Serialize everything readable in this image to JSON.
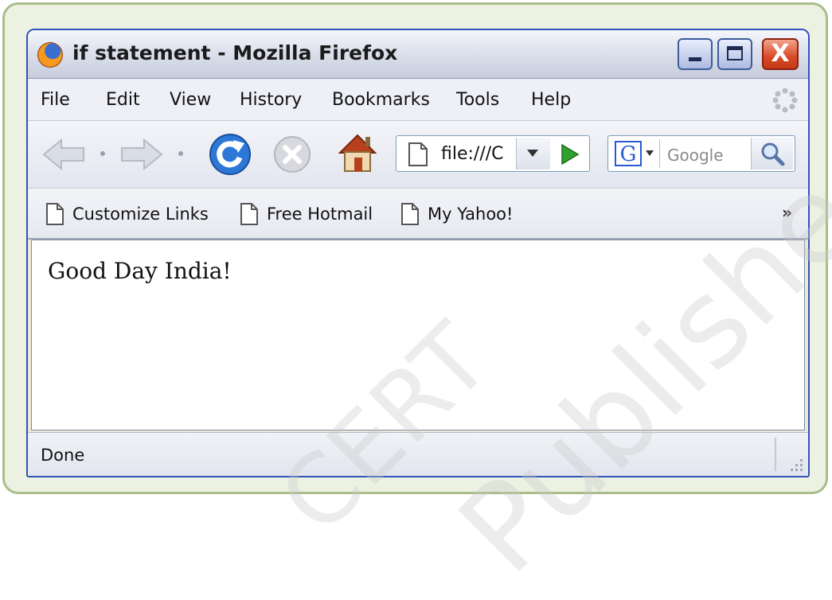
{
  "window": {
    "title": "if statement - Mozilla Firefox",
    "controls": {
      "close_glyph": "X"
    }
  },
  "menubar": {
    "items": [
      {
        "label": "File"
      },
      {
        "label": "Edit"
      },
      {
        "label": "View"
      },
      {
        "label": "History"
      },
      {
        "label": "Bookmarks"
      },
      {
        "label": "Tools"
      },
      {
        "label": "Help"
      }
    ]
  },
  "navbar": {
    "url_value": "file:///C",
    "search_placeholder": "Google",
    "search_engine_letter": "G"
  },
  "bookmarks": {
    "items": [
      {
        "label": "Customize Links"
      },
      {
        "label": "Free Hotmail"
      },
      {
        "label": "My Yahoo!"
      }
    ],
    "overflow": "»"
  },
  "content": {
    "text": "Good Day India!"
  },
  "status": {
    "text": "Done"
  },
  "watermark": {
    "left": "CERT",
    "right": "Published"
  },
  "colors": {
    "frame_border": "#a9bd8a",
    "window_border": "#2f55b8",
    "close_button": "#d84a25",
    "go_arrow": "#2fa12f",
    "reload_blue": "#2d78d7"
  },
  "icons": [
    "firefox-logo",
    "minimize-icon",
    "maximize-icon",
    "close-icon",
    "throbber-icon",
    "back-arrow-icon",
    "forward-arrow-icon",
    "reload-icon",
    "stop-icon",
    "home-icon",
    "page-icon",
    "go-arrow-icon",
    "google-g-icon",
    "magnifier-icon",
    "resize-grip-icon"
  ]
}
